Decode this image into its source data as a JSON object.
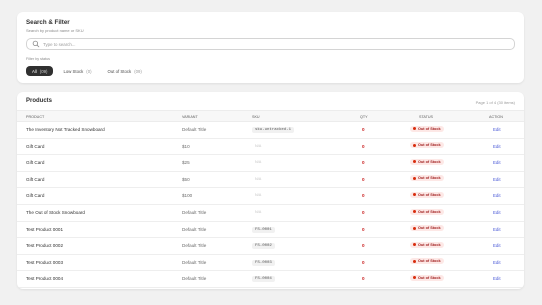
{
  "filter_card": {
    "title": "Search & Filter",
    "subtitle": "Search by product name or SKU",
    "search_placeholder": "Type to search...",
    "filter_label": "Filter by status",
    "pills": [
      {
        "label": "All",
        "count": "(09)",
        "active": true
      },
      {
        "label": "Low Stock",
        "count": "(0)",
        "active": false
      },
      {
        "label": "Out of Stock",
        "count": "(09)",
        "active": false
      }
    ]
  },
  "products": {
    "title": "Products",
    "page_info": "Page 1 of 4 (30 items)",
    "columns": [
      "PRODUCT",
      "VARIANT",
      "SKU",
      "QTY",
      "STATUS",
      "ACTION"
    ],
    "rows": [
      {
        "product": "The Inventory Not Tracked Snowboard",
        "variant": "Default Title",
        "sku": "sku-untracked-1",
        "qty": "0",
        "status": "Out of Stock",
        "action": "Edit"
      },
      {
        "product": "Gift Card",
        "variant": "$10",
        "sku": "N/A",
        "qty": "0",
        "status": "Out of Stock",
        "action": "Edit"
      },
      {
        "product": "Gift Card",
        "variant": "$25",
        "sku": "N/A",
        "qty": "0",
        "status": "Out of Stock",
        "action": "Edit"
      },
      {
        "product": "Gift Card",
        "variant": "$50",
        "sku": "N/A",
        "qty": "0",
        "status": "Out of Stock",
        "action": "Edit"
      },
      {
        "product": "Gift Card",
        "variant": "$100",
        "sku": "N/A",
        "qty": "0",
        "status": "Out of Stock",
        "action": "Edit"
      },
      {
        "product": "The Out of Stock Snowboard",
        "variant": "Default Title",
        "sku": "N/A",
        "qty": "0",
        "status": "Out of Stock",
        "action": "Edit"
      },
      {
        "product": "Test Product 0001",
        "variant": "Default Title",
        "sku": "FS-0001",
        "qty": "0",
        "status": "Out of Stock",
        "action": "Edit"
      },
      {
        "product": "Test Product 0002",
        "variant": "Default Title",
        "sku": "FS-0002",
        "qty": "0",
        "status": "Out of Stock",
        "action": "Edit"
      },
      {
        "product": "Test Product 0003",
        "variant": "Default Title",
        "sku": "FS-0003",
        "qty": "0",
        "status": "Out of Stock",
        "action": "Edit"
      },
      {
        "product": "Test Product 0004",
        "variant": "Default Title",
        "sku": "FS-0004",
        "qty": "0",
        "status": "Out of Stock",
        "action": "Edit"
      }
    ]
  },
  "colors": {
    "background": "#f1f1f1",
    "card": "#ffffff",
    "active_pill": "#303030",
    "qty_red": "#c91c1c",
    "badge_bg": "#fde8e6",
    "badge_text": "#a11f1f",
    "link": "#4a5ad7"
  },
  "icons": {
    "search": "search-icon"
  }
}
